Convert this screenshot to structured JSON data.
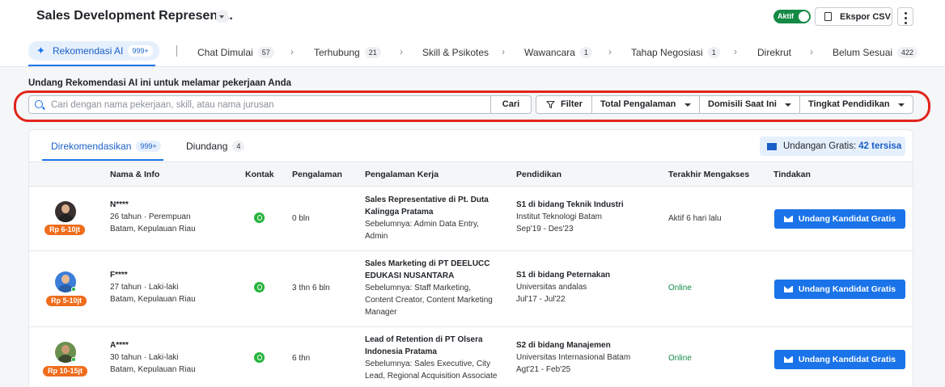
{
  "header": {
    "job_title": "Sales Development Represent...",
    "active_label": "Aktif",
    "export_label": "Ekspor CSV"
  },
  "stages": [
    {
      "label": "Rekomendasi AI",
      "count": "999+"
    },
    {
      "label": "Chat Dimulai",
      "count": "57"
    },
    {
      "label": "Terhubung",
      "count": "21"
    },
    {
      "label": "Skill & Psikotes",
      "count": ""
    },
    {
      "label": "Wawancara",
      "count": "1"
    },
    {
      "label": "Tahap Negosiasi",
      "count": "1"
    },
    {
      "label": "Direkrut",
      "count": ""
    },
    {
      "label": "Belum Sesuai",
      "count": "422"
    }
  ],
  "invite": {
    "title": "Undang Rekomendasi AI ini untuk melamar pekerjaan Anda",
    "search_placeholder": "Cari dengan nama pekerjaan, skill, atau nama jurusan",
    "search_button": "Cari",
    "filter_label": "Filter",
    "filter_experience": "Total Pengalaman",
    "filter_domicile": "Domisili Saat Ini",
    "filter_education": "Tingkat Pendidikan"
  },
  "subtabs": [
    {
      "label": "Direkomendasikan",
      "count": "999+"
    },
    {
      "label": "Diundang",
      "count": "4"
    }
  ],
  "quota": {
    "label": "Undangan Gratis:",
    "value": "42 tersisa"
  },
  "columns": [
    "Nama & Info",
    "Kontak",
    "Pengalaman",
    "Pengalaman Kerja",
    "Pendidikan",
    "Terakhir Mengakses",
    "Tindakan"
  ],
  "candidates": [
    {
      "name": "N****",
      "age_gender": "26 tahun · Perempuan",
      "location": "Batam, Kepulauan Riau",
      "salary": "Rp 6-10jt",
      "experience": "0 bln",
      "job_line1": "Sales Representative di Pt. Duta",
      "job_line2": "Kalingga Pratama",
      "prev_line1": "Sebelumnya: Admin Data Entry,",
      "prev_line2": "Admin",
      "prev_line3": "",
      "edu_title": "S1 di bidang Teknik Industri",
      "edu_school": "Institut Teknologi Batam",
      "edu_period": "Sep'19 - Des'23",
      "last_access": "Aktif 6 hari lalu",
      "online": false,
      "action": "Undang Kandidat Gratis"
    },
    {
      "name": "F****",
      "age_gender": "27 tahun · Laki-laki",
      "location": "Batam, Kepulauan Riau",
      "salary": "Rp 5-10jt",
      "experience": "3 thn 6 bln",
      "job_line1": "Sales Marketing di PT DEELUCC",
      "job_line2": "EDUKASI NUSANTARA",
      "prev_line1": "Sebelumnya: Staff Marketing,",
      "prev_line2": "Content Creator, Content Marketing",
      "prev_line3": "Manager",
      "edu_title": "S1 di bidang Peternakan",
      "edu_school": "Universitas andalas",
      "edu_period": "Jul'17 - Jul'22",
      "last_access": "Online",
      "online": true,
      "action": "Undang Kandidat Gratis"
    },
    {
      "name": "A****",
      "age_gender": "30 tahun · Laki-laki",
      "location": "Batam, Kepulauan Riau",
      "salary": "Rp 10-15jt",
      "experience": "6 thn",
      "job_line1": "Lead of Retention di PT Olsera",
      "job_line2": "Indonesia Pratama",
      "prev_line1": "Sebelumnya: Sales Executive, City",
      "prev_line2": "Lead, Regional Acquisition Associate",
      "prev_line3": "",
      "edu_title": "S2 di bidang Manajemen",
      "edu_school": "Universitas Internasional Batam",
      "edu_period": "Agt'21 - Feb'25",
      "last_access": "Online",
      "online": true,
      "action": "Undang Kandidat Gratis"
    }
  ],
  "colors": {
    "primary": "#1a73e8",
    "salary_badge": "#ef6c1a",
    "online": "#148a45",
    "highlight": "#e2231a"
  }
}
